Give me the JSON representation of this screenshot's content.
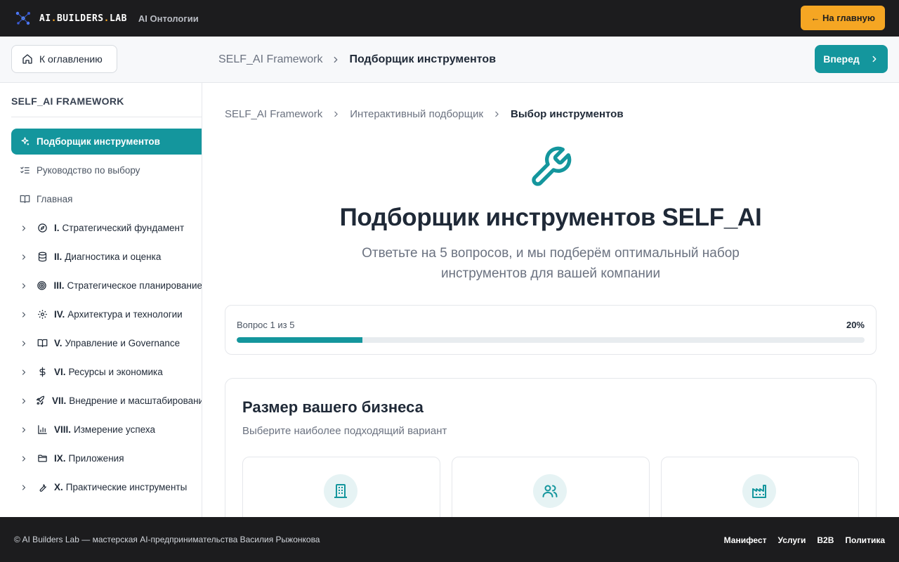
{
  "header": {
    "logo_prefix": "AI",
    "logo_mid": "BUILDERS",
    "logo_suffix": "LAB",
    "logo_dot": ".",
    "section": "AI Онтологии",
    "home_button": "← На главную"
  },
  "subbar": {
    "toc_button": "К оглавлению",
    "breadcrumb": [
      "SELF_AI Framework",
      "Подборщик инструментов"
    ],
    "next_button": "Вперед"
  },
  "sidebar": {
    "title": "SELF_AI FRAMEWORK",
    "top_items": [
      {
        "label": "Подборщик инструментов",
        "icon": "sparkle-icon",
        "active": true
      },
      {
        "label": "Руководство по выбору",
        "icon": "checklist-icon"
      },
      {
        "label": "Главная",
        "icon": "book-icon"
      }
    ],
    "sections": [
      {
        "num": "I.",
        "label": "Стратегический фундамент",
        "icon": "compass-icon"
      },
      {
        "num": "II.",
        "label": "Диагностика и оценка",
        "icon": "database-icon"
      },
      {
        "num": "III.",
        "label": "Стратегическое планирование",
        "icon": "target-icon"
      },
      {
        "num": "IV.",
        "label": "Архитектура и технологии",
        "icon": "gear-icon"
      },
      {
        "num": "V.",
        "label": "Управление и Governance",
        "icon": "book-open-icon"
      },
      {
        "num": "VI.",
        "label": "Ресурсы и экономика",
        "icon": "dollar-icon"
      },
      {
        "num": "VII.",
        "label": "Внедрение и масштабирование",
        "icon": "rocket-icon"
      },
      {
        "num": "VIII.",
        "label": "Измерение успеха",
        "icon": "bar-chart-icon"
      },
      {
        "num": "IX.",
        "label": "Приложения",
        "icon": "folder-icon"
      },
      {
        "num": "X.",
        "label": "Практические инструменты",
        "icon": "wrench-icon"
      }
    ]
  },
  "main": {
    "breadcrumb": [
      "SELF_AI Framework",
      "Интерактивный подборщик",
      "Выбор инструментов"
    ],
    "title": "Подборщик инструментов SELF_AI",
    "subtitle": "Ответьте на 5 вопросов, и мы подберём оптимальный набор инструментов для вашей компании",
    "progress": {
      "label": "Вопрос 1 из 5",
      "percent_label": "20%",
      "value": 0.2
    },
    "question": {
      "title": "Размер вашего бизнеса",
      "subtitle": "Выберите наиболее подходящий вариант",
      "options": [
        {
          "icon": "building-icon"
        },
        {
          "icon": "users-icon"
        },
        {
          "icon": "factory-icon"
        }
      ]
    }
  },
  "footer": {
    "copyright": "© AI Builders Lab — мастерская AI-предпринимательства Василия Рыжонкова",
    "links": [
      "Манифест",
      "Услуги",
      "B2B",
      "Политика"
    ]
  },
  "colors": {
    "accent": "#14969d",
    "cta": "#f5a623",
    "dark": "#1c1c1e"
  }
}
